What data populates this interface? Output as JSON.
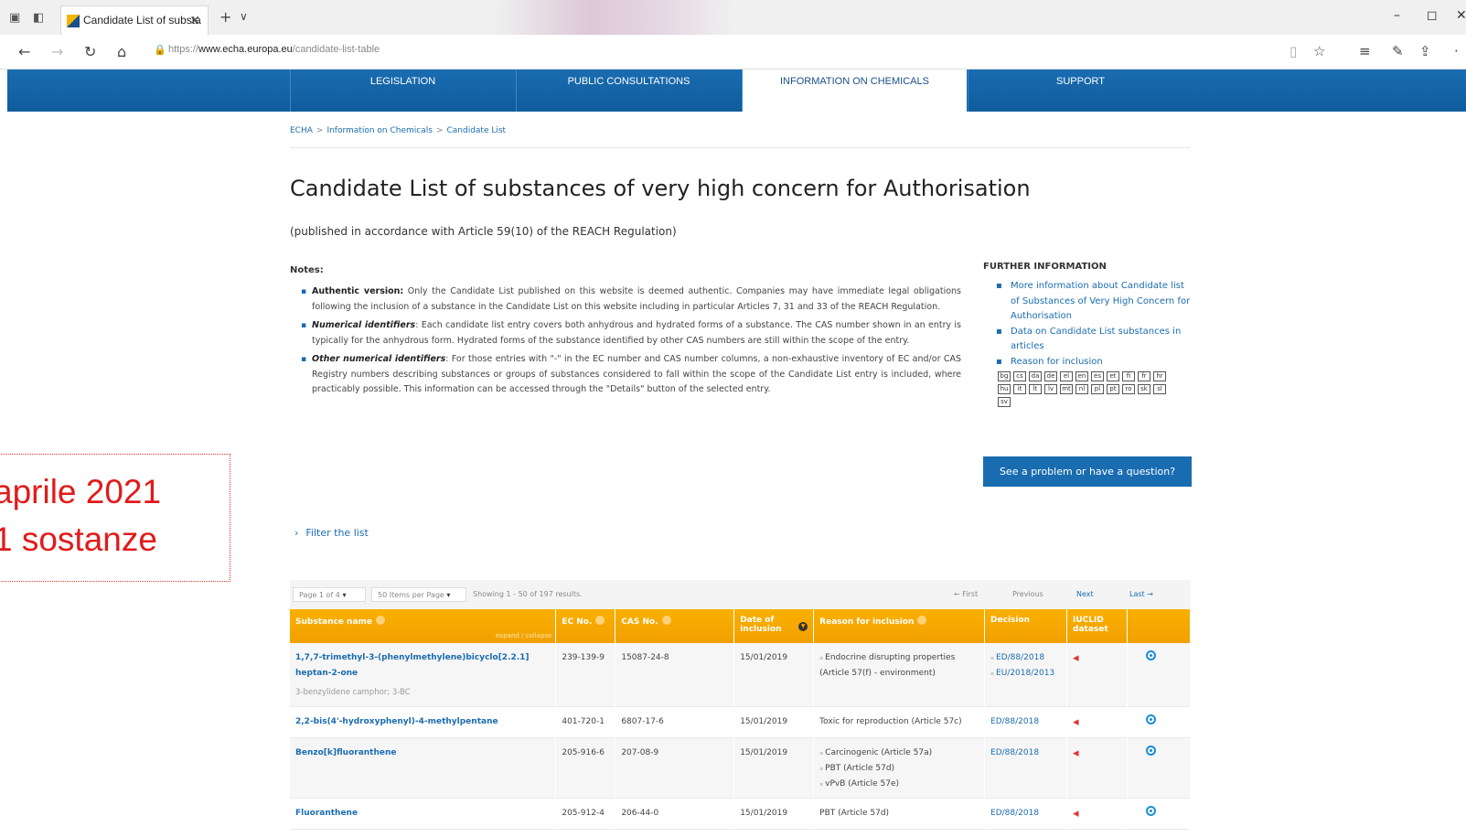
{
  "browser": {
    "tab_title": "Candidate List of substa",
    "url_prefix": "https://",
    "url_domain": "www.echa.europa.eu",
    "url_path": "/candidate-list-table"
  },
  "nav": [
    "LEGISLATION",
    "PUBLIC CONSULTATIONS",
    "INFORMATION ON CHEMICALS",
    "SUPPORT"
  ],
  "breadcrumb": [
    "ECHA",
    "Information on Chemicals",
    "Candidate List"
  ],
  "page": {
    "title": "Candidate List of substances of very high concern for Authorisation",
    "subtitle": "(published in accordance with Article 59(10) of the REACH Regulation)"
  },
  "notes": {
    "title": "Notes:",
    "items": [
      {
        "label": "Authentic version:",
        "text": "Only the Candidate List published on this website is deemed authentic. Companies may have immediate legal obligations following the inclusion of a substance in the Candidate List on this website including in particular Articles 7, 31 and 33 of the REACH Regulation."
      },
      {
        "label": "Numerical identifiers",
        "text": ": Each candidate list entry covers both anhydrous and hydrated forms of a substance. The CAS number shown in an entry is typically for the anhydrous form. Hydrated forms of the substance identified by other CAS numbers are still within the scope of the entry."
      },
      {
        "label": "Other numerical identifiers",
        "text": ": For those entries with \"-\" in the EC number and CAS number columns, a non-exhaustive inventory of EC and/or CAS Registry numbers describing substances or groups of substances considered to fall within the scope of the Candidate List entry is included, where practicably possible. This information can be accessed through the \"Details\" button of the selected entry."
      }
    ]
  },
  "further_info": {
    "title": "FURTHER INFORMATION",
    "links": [
      "More information about Candidate list of Substances of Very High Concern for Authorisation",
      "Data on Candidate List substances in articles",
      "Reason for inclusion"
    ],
    "languages": [
      "bg",
      "cs",
      "da",
      "de",
      "el",
      "en",
      "es",
      "et",
      "fi",
      "fr",
      "hr",
      "hu",
      "it",
      "lt",
      "lv",
      "mt",
      "nl",
      "pl",
      "pt",
      "ro",
      "sk",
      "sl",
      "sv"
    ]
  },
  "problem_button": "See a problem or have a question?",
  "annotation": {
    "line1": "aprile 2021",
    "line2": "1 sostanze"
  },
  "filter_label": "Filter the list",
  "pager": {
    "page": "Page 1 of 4",
    "per_page": "50 Items per Page",
    "showing": "Showing 1 - 50 of 197 results.",
    "first": "← First",
    "previous": "Previous",
    "next": "Next",
    "last": "Last →"
  },
  "table": {
    "headers": {
      "name": "Substance name",
      "expand": "expand / collapse",
      "ec": "EC No.",
      "cas": "CAS No.",
      "date": "Date of inclusion",
      "reason": "Reason for inclusion",
      "decision": "Decision",
      "iuclid": "IUCLID dataset"
    },
    "rows": [
      {
        "name": "1,7,7-trimethyl-3-(phenylmethylene)bicyclo[2.2.1] heptan-2-one",
        "alt": "3-benzylidene camphor; 3-BC",
        "ec": "239-139-9",
        "cas": "15087-24-8",
        "date": "15/01/2019",
        "reasons": [
          "Endocrine disrupting properties (Article 57(f) - environment)"
        ],
        "decisions": [
          "ED/88/2018",
          "EU/2018/2013"
        ]
      },
      {
        "name": "2,2-bis(4'-hydroxyphenyl)-4-methylpentane",
        "alt": "",
        "ec": "401-720-1",
        "cas": "6807-17-6",
        "date": "15/01/2019",
        "reasons": [
          "Toxic for reproduction (Article 57c)"
        ],
        "decisions": [
          "ED/88/2018"
        ]
      },
      {
        "name": "Benzo[k]fluoranthene",
        "alt": "",
        "ec": "205-916-6",
        "cas": "207-08-9",
        "date": "15/01/2019",
        "reasons": [
          "Carcinogenic (Article 57a)",
          "PBT (Article 57d)",
          "vPvB (Article 57e)"
        ],
        "decisions": [
          "ED/88/2018"
        ]
      },
      {
        "name": "Fluoranthene",
        "alt": "",
        "ec": "205-912-4",
        "cas": "206-44-0",
        "date": "15/01/2019",
        "reasons": [
          "PBT (Article 57d)"
        ],
        "decisions": [
          "ED/88/2018"
        ]
      }
    ]
  }
}
